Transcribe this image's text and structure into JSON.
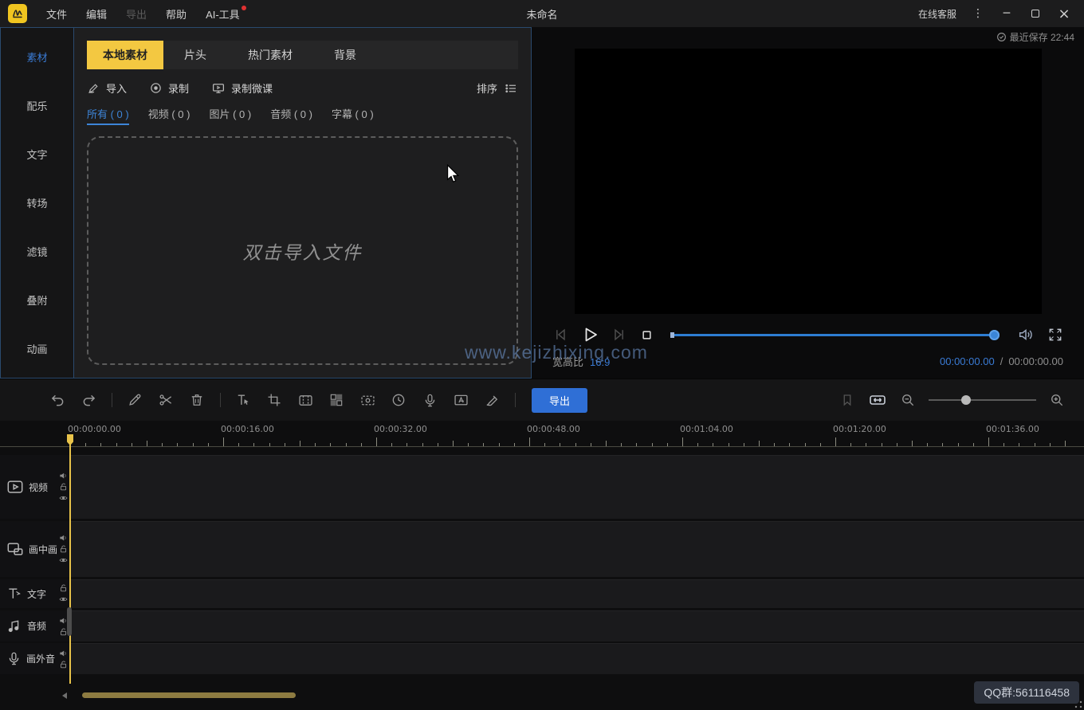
{
  "titlebar": {
    "menus": [
      "文件",
      "编辑",
      "导出",
      "帮助",
      "AI-工具"
    ],
    "title": "未命名",
    "online_service": "在线客服"
  },
  "sidebar": {
    "items": [
      "素材",
      "配乐",
      "文字",
      "转场",
      "滤镜",
      "叠附",
      "动画"
    ],
    "active": "素材"
  },
  "media_panel": {
    "tabs": [
      "本地素材",
      "片头",
      "热门素材",
      "背景"
    ],
    "active_tab": "本地素材",
    "import_label": "导入",
    "record_label": "录制",
    "record_lesson_label": "录制微课",
    "sort_label": "排序",
    "filters": [
      "所有 ( 0 )",
      "视频 ( 0 )",
      "图片 ( 0 )",
      "音频 ( 0 )",
      "字幕 ( 0 )"
    ],
    "active_filter": "所有 ( 0 )",
    "dropzone_hint": "双击导入文件"
  },
  "player": {
    "last_saved": "最近保存 22:44",
    "aspect_label": "宽高比",
    "aspect_value": "16:9",
    "current_time": "00:00:00.00",
    "separator": "/",
    "total_time": "00:00:00.00"
  },
  "watermark": "www.kejizhixing.com",
  "toolbar": {
    "export_label": "导出"
  },
  "timeline": {
    "ruler_labels": [
      "00:00:00.00",
      "00:00:16.00",
      "00:00:32.00",
      "00:00:48.00",
      "00:01:04.00",
      "00:01:20.00",
      "00:01:36.00"
    ],
    "tracks": [
      {
        "label": "视频",
        "icons": [
          "speaker",
          "lock",
          "eye"
        ]
      },
      {
        "label": "画中画",
        "icons": [
          "speaker",
          "lock",
          "eye"
        ]
      },
      {
        "label": "文字",
        "icons": [
          "lock",
          "eye"
        ]
      },
      {
        "label": "音频",
        "icons": [
          "speaker",
          "lock"
        ]
      },
      {
        "label": "画外音",
        "icons": [
          "speaker",
          "lock"
        ]
      }
    ]
  },
  "footer": {
    "qq_badge": "QQ群:561116458"
  },
  "colors": {
    "accent_blue": "#3a7bd5",
    "accent_yellow": "#f3c841",
    "export_blue": "#2f6fd6",
    "playhead_yellow": "#e8c34a",
    "scrollbar_gold": "#8d7b41",
    "panel_border": "#2a4a6e"
  }
}
